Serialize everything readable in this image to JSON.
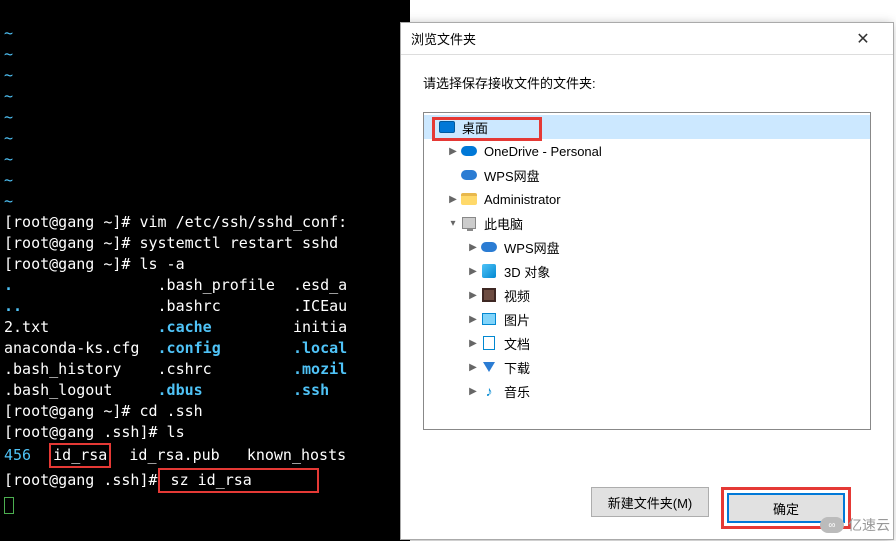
{
  "terminal": {
    "tilde_lines": [
      "~",
      "~",
      "~",
      "~",
      "~",
      "~",
      "~",
      "~",
      "~"
    ],
    "cmd1_prompt": "[root@gang ~]#",
    "cmd1": " vim /etc/ssh/sshd_conf:",
    "cmd2_prompt": "[root@gang ~]#",
    "cmd2": " systemctl restart sshd",
    "cmd3_prompt": "[root@gang ~]#",
    "cmd3": " ls -a",
    "ls_dot": ".",
    "ls_profile": ".bash_profile",
    "ls_esd": ".esd_a",
    "ls_dotdot": "..",
    "ls_bashrc": ".bashrc",
    "ls_ice": ".ICEau",
    "ls_2txt": "2.txt",
    "ls_cache": ".cache",
    "ls_initi": "initia",
    "ls_anaconda": "anaconda-ks.cfg",
    "ls_config": ".config",
    "ls_local": ".local",
    "ls_bashhist": ".bash_history",
    "ls_cshrc": ".cshrc",
    "ls_mozi": ".mozil",
    "ls_bashlogout": ".bash_logout",
    "ls_dbus": ".dbus",
    "ls_ssh": ".ssh",
    "cmd4_prompt": "[root@gang ~]#",
    "cmd4": " cd .ssh",
    "cmd5_prompt": "[root@gang .ssh]#",
    "cmd5": " ls",
    "ls2_456": "456",
    "ls2_idrsa": "id_rsa",
    "ls2_pub": "id_rsa.pub",
    "ls2_known": "known_hosts",
    "cmd6_prompt": "[root@gang .ssh]#",
    "cmd6": " sz id_rsa"
  },
  "dialog": {
    "title": "浏览文件夹",
    "instruction": "请选择保存接收文件的文件夹:",
    "tree": {
      "desktop": "桌面",
      "onedrive": "OneDrive - Personal",
      "wps1": "WPS网盘",
      "admin": "Administrator",
      "thispc": "此电脑",
      "wps2": "WPS网盘",
      "obj3d": "3D 对象",
      "video": "视频",
      "pictures": "图片",
      "docs": "文档",
      "downloads": "下载",
      "music": "音乐"
    },
    "buttons": {
      "newfolder": "新建文件夹(M)",
      "ok": "确定"
    }
  },
  "watermark": "亿速云"
}
